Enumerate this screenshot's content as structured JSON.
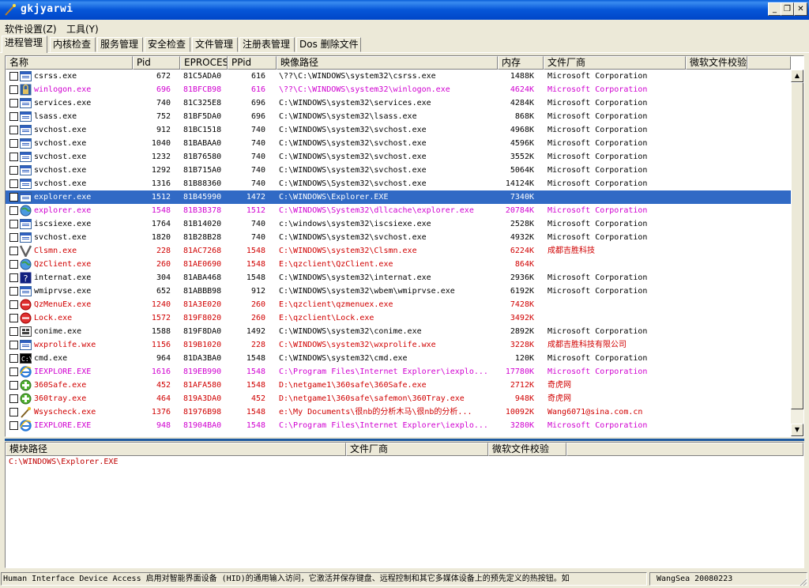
{
  "window": {
    "title": "gkjyarwi",
    "min": "_",
    "restore": "❐",
    "close": "✕"
  },
  "menu": [
    "软件设置(Z)",
    "工具(Y)"
  ],
  "tabs": [
    "进程管理",
    "内核检查",
    "服务管理",
    "安全检查",
    "文件管理",
    "注册表管理",
    "Dos 删除文件"
  ],
  "active_tab": 0,
  "process_table": {
    "columns": [
      "名称",
      "Pid",
      "EPROCESS",
      "PPid",
      "映像路径",
      "内存",
      "文件厂商",
      "微软文件校验"
    ],
    "rows": [
      {
        "name": "csrss.exe",
        "pid": "672",
        "eprocess": "81C5ADA0",
        "ppid": "616",
        "path": "\\??\\C:\\WINDOWS\\system32\\csrss.exe",
        "mem": "1488K",
        "vendor": "Microsoft Corporation",
        "color": "#000000",
        "icon": "window-icon"
      },
      {
        "name": "winlogon.exe",
        "pid": "696",
        "eprocess": "81BFCB98",
        "ppid": "616",
        "path": "\\??\\C:\\WINDOWS\\system32\\winlogon.exe",
        "mem": "4624K",
        "vendor": "Microsoft Corporation",
        "color": "#d000d0",
        "icon": "lock-icon"
      },
      {
        "name": "services.exe",
        "pid": "740",
        "eprocess": "81C325E8",
        "ppid": "696",
        "path": "C:\\WINDOWS\\system32\\services.exe",
        "mem": "4284K",
        "vendor": "Microsoft Corporation",
        "color": "#000000",
        "icon": "window-icon"
      },
      {
        "name": "lsass.exe",
        "pid": "752",
        "eprocess": "81BF5DA0",
        "ppid": "696",
        "path": "C:\\WINDOWS\\system32\\lsass.exe",
        "mem": "868K",
        "vendor": "Microsoft Corporation",
        "color": "#000000",
        "icon": "window-icon"
      },
      {
        "name": "svchost.exe",
        "pid": "912",
        "eprocess": "81BC1518",
        "ppid": "740",
        "path": "C:\\WINDOWS\\system32\\svchost.exe",
        "mem": "4968K",
        "vendor": "Microsoft Corporation",
        "color": "#000000",
        "icon": "window-icon"
      },
      {
        "name": "svchost.exe",
        "pid": "1040",
        "eprocess": "81BABAA0",
        "ppid": "740",
        "path": "C:\\WINDOWS\\system32\\svchost.exe",
        "mem": "4596K",
        "vendor": "Microsoft Corporation",
        "color": "#000000",
        "icon": "window-icon"
      },
      {
        "name": "svchost.exe",
        "pid": "1232",
        "eprocess": "81B76580",
        "ppid": "740",
        "path": "C:\\WINDOWS\\system32\\svchost.exe",
        "mem": "3552K",
        "vendor": "Microsoft Corporation",
        "color": "#000000",
        "icon": "window-icon"
      },
      {
        "name": "svchost.exe",
        "pid": "1292",
        "eprocess": "81B715A0",
        "ppid": "740",
        "path": "C:\\WINDOWS\\system32\\svchost.exe",
        "mem": "5064K",
        "vendor": "Microsoft Corporation",
        "color": "#000000",
        "icon": "window-icon"
      },
      {
        "name": "svchost.exe",
        "pid": "1316",
        "eprocess": "81B88360",
        "ppid": "740",
        "path": "C:\\WINDOWS\\System32\\svchost.exe",
        "mem": "14124K",
        "vendor": "Microsoft Corporation",
        "color": "#000000",
        "icon": "window-icon"
      },
      {
        "name": "explorer.exe",
        "pid": "1512",
        "eprocess": "81B45990",
        "ppid": "1472",
        "path": "C:\\WINDOWS\\Explorer.EXE",
        "mem": "7340K",
        "vendor": "",
        "color": "#ffffff",
        "icon": "window-icon",
        "selected": true
      },
      {
        "name": "explorer.exe",
        "pid": "1548",
        "eprocess": "81B3B378",
        "ppid": "1512",
        "path": "C:\\WINDOWS\\System32\\dllcache\\explorer.exe",
        "mem": "20784K",
        "vendor": "Microsoft Corporation",
        "color": "#d000d0",
        "icon": "globe-icon"
      },
      {
        "name": "iscsiexe.exe",
        "pid": "1764",
        "eprocess": "81B14020",
        "ppid": "740",
        "path": "c:\\windows\\system32\\iscsiexe.exe",
        "mem": "2528K",
        "vendor": "Microsoft Corporation",
        "color": "#000000",
        "icon": "window-icon"
      },
      {
        "name": "svchost.exe",
        "pid": "1820",
        "eprocess": "81B28B28",
        "ppid": "740",
        "path": "C:\\WINDOWS\\system32\\svchost.exe",
        "mem": "4932K",
        "vendor": "Microsoft Corporation",
        "color": "#000000",
        "icon": "window-icon"
      },
      {
        "name": "Clsmn.exe",
        "pid": "228",
        "eprocess": "81AC7268",
        "ppid": "1548",
        "path": "C:\\WINDOWS\\system32\\Clsmn.exe",
        "mem": "6224K",
        "vendor": "成都吉胜科技",
        "color": "#d00000",
        "icon": "v-icon"
      },
      {
        "name": "QzClient.exe",
        "pid": "260",
        "eprocess": "81AE0690",
        "ppid": "1548",
        "path": "E:\\qzclient\\QzClient.exe",
        "mem": "864K",
        "vendor": "",
        "color": "#d00000",
        "icon": "globe-icon"
      },
      {
        "name": "internat.exe",
        "pid": "304",
        "eprocess": "81ABA468",
        "ppid": "1548",
        "path": "C:\\WINDOWS\\system32\\internat.exe",
        "mem": "2936K",
        "vendor": "Microsoft Corporation",
        "color": "#000000",
        "icon": "help-icon"
      },
      {
        "name": "wmiprvse.exe",
        "pid": "652",
        "eprocess": "81ABBB98",
        "ppid": "912",
        "path": "C:\\WINDOWS\\system32\\wbem\\wmiprvse.exe",
        "mem": "6192K",
        "vendor": "Microsoft Corporation",
        "color": "#000000",
        "icon": "window-icon"
      },
      {
        "name": "QzMenuEx.exe",
        "pid": "1240",
        "eprocess": "81A3E020",
        "ppid": "260",
        "path": "E:\\qzclient\\qzmenuex.exe",
        "mem": "7428K",
        "vendor": "",
        "color": "#d00000",
        "icon": "red-circle-icon"
      },
      {
        "name": "Lock.exe",
        "pid": "1572",
        "eprocess": "819F8020",
        "ppid": "260",
        "path": "E:\\qzclient\\Lock.exe",
        "mem": "3492K",
        "vendor": "",
        "color": "#d00000",
        "icon": "red-circle-icon"
      },
      {
        "name": "conime.exe",
        "pid": "1588",
        "eprocess": "819F8DA0",
        "ppid": "1492",
        "path": "C:\\WINDOWS\\system32\\conime.exe",
        "mem": "2892K",
        "vendor": "Microsoft Corporation",
        "color": "#000000",
        "icon": "ime-icon"
      },
      {
        "name": "wxprolife.wxe",
        "pid": "1156",
        "eprocess": "819B1020",
        "ppid": "228",
        "path": "C:\\WINDOWS\\system32\\wxprolife.wxe",
        "mem": "3228K",
        "vendor": "成都吉胜科技有限公司",
        "color": "#d00000",
        "icon": "window-icon"
      },
      {
        "name": "cmd.exe",
        "pid": "964",
        "eprocess": "81DA3BA0",
        "ppid": "1548",
        "path": "C:\\WINDOWS\\system32\\cmd.exe",
        "mem": "120K",
        "vendor": "Microsoft Corporation",
        "color": "#000000",
        "icon": "console-icon"
      },
      {
        "name": "IEXPLORE.EXE",
        "pid": "1616",
        "eprocess": "819EB990",
        "ppid": "1548",
        "path": "C:\\Program Files\\Internet Explorer\\iexplo...",
        "mem": "17780K",
        "vendor": "Microsoft Corporation",
        "color": "#d000d0",
        "icon": "ie-icon"
      },
      {
        "name": "360Safe.exe",
        "pid": "452",
        "eprocess": "81AFA580",
        "ppid": "1548",
        "path": "D:\\netgame1\\360safe\\360Safe.exe",
        "mem": "2712K",
        "vendor": "奇虎网",
        "color": "#d00000",
        "icon": "shield-plus-icon"
      },
      {
        "name": "360tray.exe",
        "pid": "464",
        "eprocess": "819A3DA0",
        "ppid": "452",
        "path": "D:\\netgame1\\360safe\\safemon\\360Tray.exe",
        "mem": "948K",
        "vendor": "奇虎网",
        "color": "#d00000",
        "icon": "shield-plus-icon"
      },
      {
        "name": "Wsyscheck.exe",
        "pid": "1376",
        "eprocess": "81976B98",
        "ppid": "1548",
        "path": "e:\\My Documents\\很nb的分析木马\\很nb的分析...",
        "mem": "10092K",
        "vendor": "Wang6071@sina.com.cn",
        "color": "#d00000",
        "icon": "wand-icon"
      },
      {
        "name": "IEXPLORE.EXE",
        "pid": "948",
        "eprocess": "81904BA0",
        "ppid": "1548",
        "path": "C:\\Program Files\\Internet Explorer\\iexplo...",
        "mem": "3280K",
        "vendor": "Microsoft Corporation",
        "color": "#d000d0",
        "icon": "ie-icon"
      }
    ]
  },
  "module_table": {
    "columns": [
      "模块路径",
      "文件厂商",
      "微软文件校验"
    ],
    "rows": [
      {
        "path": "C:\\WINDOWS\\Explorer.EXE",
        "vendor": "",
        "check": ""
      }
    ]
  },
  "status": {
    "left": "Human Interface Device Access 启用对智能界面设备 (HID)的通用输入访问，它激活并保存键盘、远程控制和其它多媒体设备上的预先定义的热按钮。如",
    "right": "WangSea 20080223"
  }
}
